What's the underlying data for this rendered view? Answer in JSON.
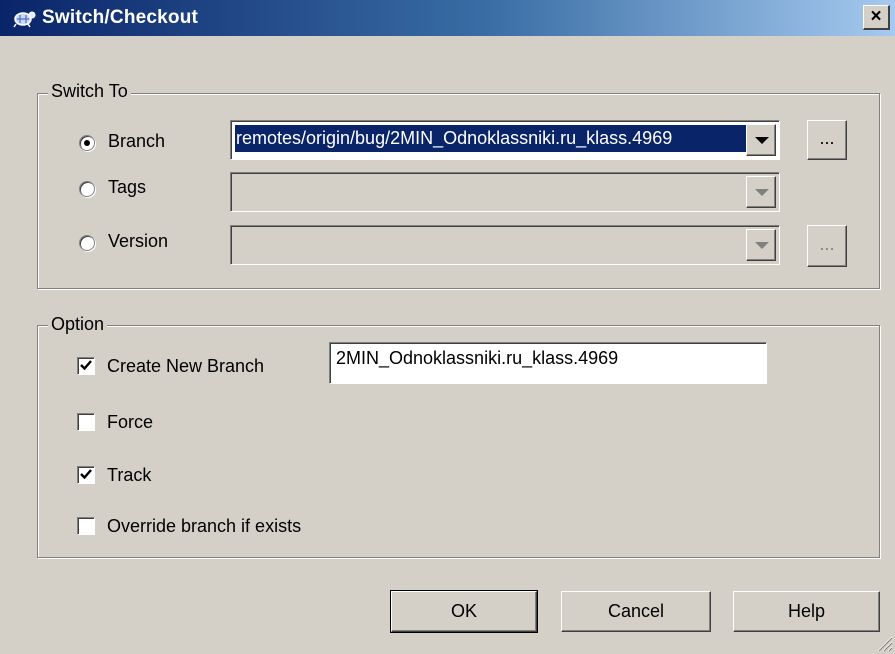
{
  "window": {
    "title": "Switch/Checkout",
    "close_label": "×",
    "icon": "tortoise-git-icon"
  },
  "switch_to": {
    "legend": "Switch To",
    "branch": {
      "label": "Branch",
      "selected": true,
      "value": "remotes/origin/bug/2MIN_Odnoklassniki.ru_klass.4969",
      "browse_label": "..."
    },
    "tags": {
      "label": "Tags",
      "selected": false,
      "value": ""
    },
    "version": {
      "label": "Version",
      "selected": false,
      "value": "",
      "browse_label": "..."
    }
  },
  "option": {
    "legend": "Option",
    "create_new_branch": {
      "label": "Create New Branch",
      "checked": true,
      "value": "2MIN_Odnoklassniki.ru_klass.4969"
    },
    "force": {
      "label": "Force",
      "checked": false
    },
    "track": {
      "label": "Track",
      "checked": true
    },
    "override": {
      "label": "Override branch if exists",
      "checked": false
    }
  },
  "buttons": {
    "ok": "OK",
    "cancel": "Cancel",
    "help": "Help"
  },
  "colors": {
    "title_start": "#0a246a",
    "title_end": "#a6caf0",
    "face": "#d4d0c8",
    "selection": "#0a246a"
  }
}
